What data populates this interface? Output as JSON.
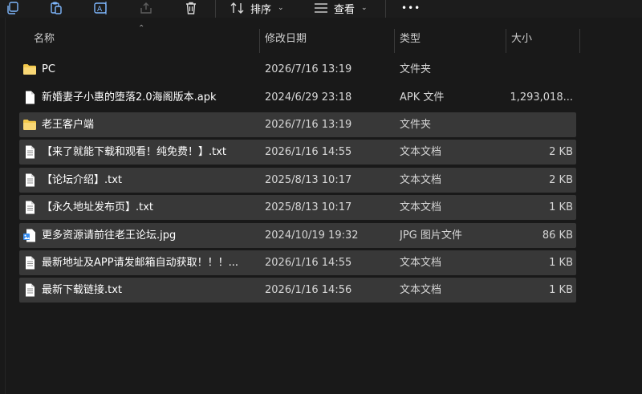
{
  "toolbar": {
    "sort_label": "排序",
    "view_label": "查看",
    "more_label": "•••"
  },
  "columns": {
    "name": "名称",
    "date": "修改日期",
    "type": "类型",
    "size": "大小"
  },
  "files": [
    {
      "icon": "folder-icon",
      "name": "PC",
      "date": "2026/7/16 13:19",
      "type": "文件夹",
      "size": "",
      "selected": false
    },
    {
      "icon": "file-icon",
      "name": "新婚妻子小惠的堕落2.0海阁版本.apk",
      "date": "2024/6/29 23:18",
      "type": "APK 文件",
      "size": "1,293,018...",
      "selected": false
    },
    {
      "icon": "folder-icon",
      "name": "老王客户端",
      "date": "2026/7/16 13:19",
      "type": "文件夹",
      "size": "",
      "selected": true
    },
    {
      "icon": "text-file-icon",
      "name": "【来了就能下载和观看！纯免费！】.txt",
      "date": "2026/1/16 14:55",
      "type": "文本文档",
      "size": "2 KB",
      "selected": true
    },
    {
      "icon": "text-file-icon",
      "name": "【论坛介绍】.txt",
      "date": "2025/8/13 10:17",
      "type": "文本文档",
      "size": "2 KB",
      "selected": true
    },
    {
      "icon": "text-file-icon",
      "name": "【永久地址发布页】.txt",
      "date": "2025/8/13 10:17",
      "type": "文本文档",
      "size": "1 KB",
      "selected": true
    },
    {
      "icon": "image-file-icon",
      "name": "更多资源请前往老王论坛.jpg",
      "date": "2024/10/19 19:32",
      "type": "JPG 图片文件",
      "size": "86 KB",
      "selected": true
    },
    {
      "icon": "text-file-icon",
      "name": "最新地址及APP请发邮箱自动获取！！！...",
      "date": "2026/1/16 14:55",
      "type": "文本文档",
      "size": "1 KB",
      "selected": true
    },
    {
      "icon": "text-file-icon",
      "name": "最新下载链接.txt",
      "date": "2026/1/16 14:56",
      "type": "文本文档",
      "size": "1 KB",
      "selected": true
    }
  ]
}
